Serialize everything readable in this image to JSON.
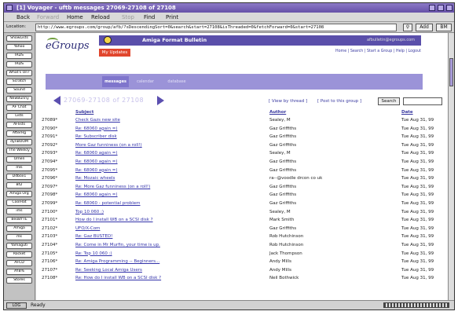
{
  "window": {
    "title": "[1] Voyager - uftb messages 27069-27108 of 27108"
  },
  "toolbar": {
    "back": "Back",
    "forward": "Forward",
    "home": "Home",
    "reload": "Reload",
    "stop": "Stop",
    "find": "Find",
    "print": "Print"
  },
  "location": {
    "label": "Location:",
    "url": "http://www.egroups.com/group/afb/?sDescendingSort=0&search&start=27108&isThreaded=0&fetchForward=0&start=27108",
    "search_button": "Search",
    "add_button": "Add",
    "bm_button": "BM"
  },
  "sidebar": {
    "items": [
      "ShowLists",
      "Yahoo",
      "IRDS",
      "IRDS",
      "What's On?",
      "Scratch",
      "Sound",
      "NewBunny",
      "AF Chat",
      "Lists",
      "AFlists",
      "AfterRg",
      "dynBOOM",
      "The Weekly",
      "Omen",
      "mls",
      "Ddbox1",
      "Bt2",
      "Amiga Org",
      "CoolHat",
      "ims",
      "BeoBYTE",
      "Amiga",
      "ms",
      "Yamaguti",
      "Rocket",
      "AFCD",
      "AYB%",
      "Stores"
    ]
  },
  "header": {
    "logo": "eGroups",
    "banner_title": "Amiga Format Bulletin",
    "banner_email": "afbulletin@egroups.com",
    "my_updates": "My Updates",
    "top_links": "Home | Search | Start a Group | Help | Logout"
  },
  "nav": {
    "tabs": [
      "messages",
      "calendar",
      "database"
    ]
  },
  "pager": {
    "range": "27069-27108 of 27108"
  },
  "links": {
    "view_by_thread": "[ View by thread ]",
    "post": "[ Post to this group ]",
    "search": "Search"
  },
  "columns": {
    "subject": "Subject",
    "author": "Author",
    "date": "Date"
  },
  "messages": [
    {
      "num": "27089*",
      "subject": "Check Gazs new site",
      "author": "Sealey, M",
      "date": "Tue Aug 31, 99"
    },
    {
      "num": "27090*",
      "subject": "Re: 68060 again =)",
      "author": "Gaz Griffiths",
      "date": "Tue Aug 31, 99"
    },
    {
      "num": "27091*",
      "subject": "Re: Subscriber disk",
      "author": "Gaz Griffiths",
      "date": "Tue Aug 31, 99"
    },
    {
      "num": "27092*",
      "subject": "More Gaz funniness (on a roll!)",
      "author": "Gaz Griffiths",
      "date": "Tue Aug 31, 99"
    },
    {
      "num": "27093*",
      "subject": "Re: 68060 again =)",
      "author": "Sealey, M",
      "date": "Tue Aug 31, 99"
    },
    {
      "num": "27094*",
      "subject": "Re: 68060 again =)",
      "author": "Gaz Griffiths",
      "date": "Tue Aug 31, 99"
    },
    {
      "num": "27095*",
      "subject": "Re: 68060 again =)",
      "author": "Gaz Griffiths",
      "date": "Tue Aug 31, 99"
    },
    {
      "num": "27096*",
      "subject": "Re: Mozaic wheels",
      "author": "ra--@voodle drcon co uk",
      "date": "Tue Aug 31, 99"
    },
    {
      "num": "27097*",
      "subject": "Re: More Gaz funniness (on a roll!)",
      "author": "Gaz Griffiths",
      "date": "Tue Aug 31, 99"
    },
    {
      "num": "27098*",
      "subject": "Re: 68060 again =)",
      "author": "Gaz Griffiths",
      "date": "Tue Aug 31, 99"
    },
    {
      "num": "27099*",
      "subject": "Re: 68060 - potential problem",
      "author": "Gaz Griffiths",
      "date": "Tue Aug 31, 99"
    },
    {
      "num": "27100*",
      "subject": "Top 10 060 :)",
      "author": "Sealey, M",
      "date": "Tue Aug 31, 99"
    },
    {
      "num": "27101*",
      "subject": "How do I install WB on a SCSI disk ?",
      "author": "Mark Smith",
      "date": "Tue Aug 31, 99"
    },
    {
      "num": "27102*",
      "subject": "UFO/X-Com",
      "author": "Gaz Griffiths",
      "date": "Tue Aug 31, 99"
    },
    {
      "num": "27103*",
      "subject": "Re: Gaz BUSTED!",
      "author": "Rob Hutchinson",
      "date": "Tue Aug 31, 99"
    },
    {
      "num": "27104*",
      "subject": "Re: Come in Mr Murfin, your time is up.",
      "author": "Rob Hutchinson",
      "date": "Tue Aug 31, 99"
    },
    {
      "num": "27105*",
      "subject": "Re: Top 10 060 :)",
      "author": "Jack Thompson",
      "date": "Tue Aug 31, 99"
    },
    {
      "num": "27106*",
      "subject": "Re: Amiga Programming -- Beginners...",
      "author": "Andy Mills",
      "date": "Tue Aug 31, 99"
    },
    {
      "num": "27107*",
      "subject": "Re: Seeking Local Amiga Users",
      "author": "Andy Mills",
      "date": "Tue Aug 31, 99"
    },
    {
      "num": "27108*",
      "subject": "Re: How do I install WB on a SCSI disk ?",
      "author": "Neil Bothwick",
      "date": "Tue Aug 31, 99"
    }
  ],
  "status": {
    "icon_label": "LOG",
    "text": "Ready"
  },
  "colors": {
    "titlebar": "#6651a8",
    "nav": "#9b93d8",
    "link": "#3333aa",
    "banner": "#5a4faa",
    "updates": "#e1462d"
  }
}
